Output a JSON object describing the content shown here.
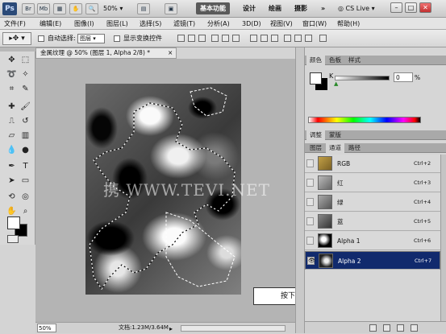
{
  "app": {
    "logo": "Ps",
    "top_icons": [
      "Br",
      "Mb"
    ],
    "zoom_menu": "50%",
    "workspaces": [
      "基本功能",
      "设计",
      "绘画",
      "摄影"
    ],
    "more": "»",
    "cs_live": "CS Live"
  },
  "menu": [
    "文件(F)",
    "编辑(E)",
    "图像(I)",
    "图层(L)",
    "选择(S)",
    "滤镜(T)",
    "分析(A)",
    "3D(D)",
    "视图(V)",
    "窗口(W)",
    "帮助(H)"
  ],
  "options": {
    "auto_select_label": "自动选择:",
    "auto_select_value": "图层",
    "show_transform_label": "显示变换控件"
  },
  "document": {
    "tab_title": "金属纹理 @ 50% (图层 1, Alpha 2/8) *",
    "zoom": "50%",
    "doc_info": "文档:1.23M/3.64M",
    "watermark": "携 WWW.TEVI.NET"
  },
  "color_panel": {
    "tabs": [
      "颜色",
      "色板",
      "样式"
    ],
    "channel_label": "K",
    "value": "0",
    "unit": "%"
  },
  "adjust_panel": {
    "tabs": [
      "调整",
      "蒙版"
    ]
  },
  "channels_panel": {
    "tabs": [
      "图层",
      "通道",
      "路径"
    ],
    "channels": [
      {
        "name": "RGB",
        "shortcut": "Ctrl+2"
      },
      {
        "name": "红",
        "shortcut": "Ctrl+3"
      },
      {
        "name": "绿",
        "shortcut": "Ctrl+4"
      },
      {
        "name": "蓝",
        "shortcut": "Ctrl+5"
      },
      {
        "name": "Alpha 1",
        "shortcut": "Ctrl+6"
      },
      {
        "name": "Alpha 2",
        "shortcut": "Ctrl+7"
      }
    ]
  },
  "callout": "按下<Ctrl>键的同时单击通道缩览图",
  "colors": {
    "selected_row": "#112a6d",
    "hue_bar": "rainbow"
  }
}
